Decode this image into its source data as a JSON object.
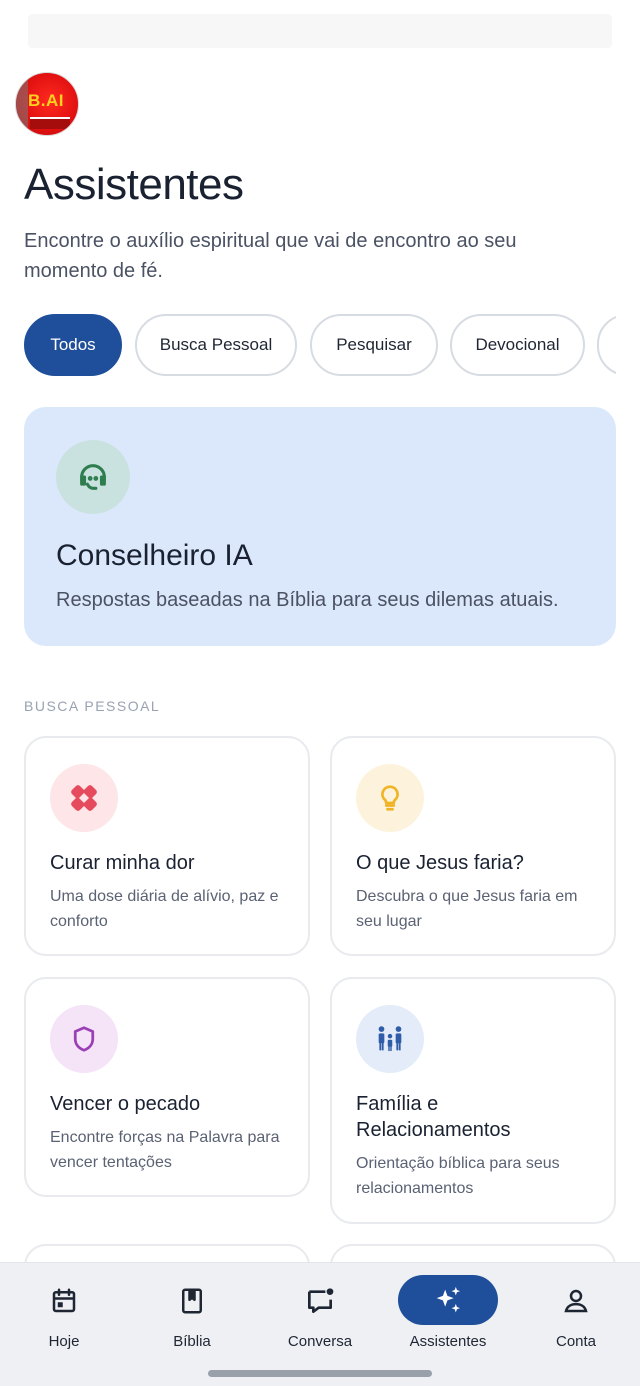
{
  "app": {
    "logo_text": "B.AI"
  },
  "header": {
    "title": "Assistentes",
    "subtitle": "Encontre o auxílio espiritual que vai de encontro ao seu momento de fé."
  },
  "filters": {
    "chips": [
      "Todos",
      "Busca Pessoal",
      "Pesquisar",
      "Devocional"
    ],
    "selected": "Todos"
  },
  "featured": {
    "title": "Conselheiro IA",
    "description": "Respostas baseadas na Bíblia para seus dilemas atuais.",
    "icon": "headset-icon"
  },
  "section": {
    "label": "BUSCA PESSOAL",
    "cards": [
      {
        "title": "Curar minha dor",
        "description": "Uma dose diária de alívio, paz e conforto",
        "icon": "bandage-icon",
        "color": "#e54a5d"
      },
      {
        "title": "O que Jesus faria?",
        "description": "Descubra o que Jesus faria em seu lugar",
        "icon": "lightbulb-icon",
        "color": "#f0b429"
      },
      {
        "title": "Vencer o pecado",
        "description": "Encontre forças na Palavra para vencer tentações",
        "icon": "shield-icon",
        "color": "#9b3fb5"
      },
      {
        "title": "Família e Relacionamentos",
        "description": "Orientação bíblica para seus relacionamentos",
        "icon": "family-icon",
        "color": "#2f5da8"
      }
    ]
  },
  "bottom_nav": {
    "items": [
      {
        "label": "Hoje",
        "icon": "calendar-icon"
      },
      {
        "label": "Bíblia",
        "icon": "bookmark-book-icon"
      },
      {
        "label": "Conversa",
        "icon": "chat-icon"
      },
      {
        "label": "Assistentes",
        "icon": "sparkles-icon"
      },
      {
        "label": "Conta",
        "icon": "person-icon"
      }
    ],
    "active": "Assistentes"
  },
  "colors": {
    "accent": "#1f4f9a",
    "hero_bg": "#dbe8fb"
  }
}
